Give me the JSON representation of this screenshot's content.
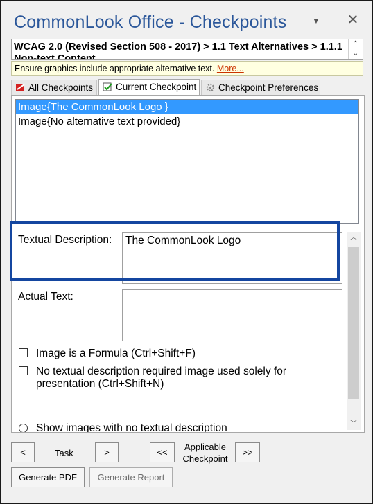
{
  "window": {
    "title": "CommonLook Office - Checkpoints",
    "dropdown_icon": "chevron-down-icon",
    "close_icon": "close-icon"
  },
  "breadcrumb": {
    "text": "WCAG 2.0 (Revised Section 508 - 2017) > 1.1 Text Alternatives > 1.1.1 Non-text Content"
  },
  "tip": {
    "text": "Ensure graphics include appropriate alternative text.",
    "link": "More..."
  },
  "tabs": [
    {
      "label": "All Checkpoints",
      "icon": "checkpoints-icon"
    },
    {
      "label": "Current Checkpoint",
      "icon": "checkmark-icon"
    },
    {
      "label": "Checkpoint Preferences",
      "icon": "gear-icon"
    }
  ],
  "list": {
    "items": [
      "Image{The CommonLook Logo }",
      "Image{No alternative text provided}"
    ],
    "selected_index": 0
  },
  "form": {
    "textual_description_label": "Textual Description:",
    "textual_description_value": "The CommonLook Logo",
    "actual_text_label": "Actual Text:",
    "actual_text_value": "",
    "formula_checkbox": "Image is a Formula (Ctrl+Shift+F)",
    "no_description_checkbox": "No textual description required image used solely for presentation (Ctrl+Shift+N)",
    "radio_no_description": "Show images with no textual description"
  },
  "nav": {
    "prev": "<",
    "task_label": "Task",
    "next": ">",
    "first": "<<",
    "checkpoint_label": "Applicable Checkpoint",
    "last": ">>"
  },
  "actions": {
    "generate_pdf": "Generate PDF",
    "generate_report": "Generate Report"
  },
  "colors": {
    "title": "#2b579a",
    "selection": "#3399ff",
    "highlight": "#1446a0",
    "tip_background": "#ffffe1",
    "tip_link": "#cc3300"
  }
}
